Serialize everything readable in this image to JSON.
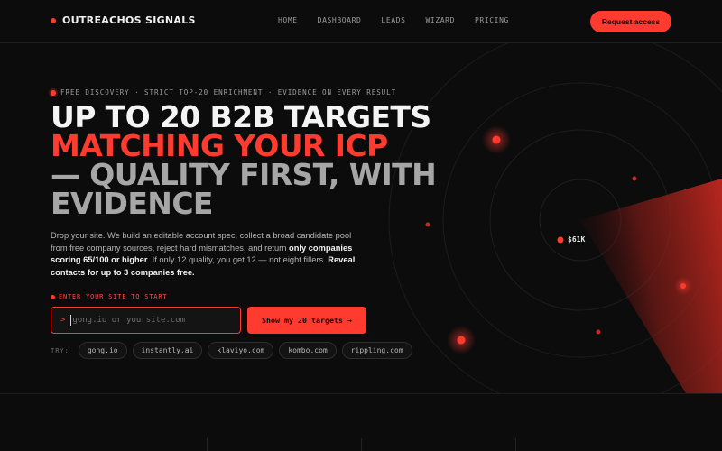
{
  "nav": {
    "brand": "OUTREACHOS SIGNALS",
    "links": [
      "HOME",
      "DASHBOARD",
      "LEADS",
      "WIZARD",
      "PRICING"
    ],
    "cta": "Request access"
  },
  "hero": {
    "eyebrow": "FREE DISCOVERY · STRICT TOP-20 ENRICHMENT · EVIDENCE ON EVERY RESULT",
    "headline_line1": "UP TO 20 B2B TARGETS",
    "headline_line2": "MATCHING YOUR ICP",
    "headline_line3": "— QUALITY FIRST, WITH",
    "headline_line4": "EVIDENCE",
    "desc_1": "Drop your site. We build an editable account spec, collect a broad candidate pool from free company sources, reject hard mismatches, and return ",
    "desc_bold_1": "only companies scoring 65/100 or higher",
    "desc_2": ". If only 12 qualify, you get 12 — not eight fillers. ",
    "desc_bold_2": "Reveal contacts for up to 3 companies free."
  },
  "form": {
    "label": "ENTER YOUR SITE TO START",
    "prompt": ">",
    "value": "",
    "placeholder": "gong.io or yoursite.com",
    "submit": "Show my 20 targets →"
  },
  "try": {
    "label": "TRY:",
    "chips": [
      "gong.io",
      "instantly.ai",
      "klaviyo.com",
      "kombo.com",
      "rippling.com"
    ]
  },
  "radar": {
    "marker_label": "$61K"
  },
  "colors": {
    "accent": "#ff3b2f",
    "background": "#0c0c0d"
  }
}
